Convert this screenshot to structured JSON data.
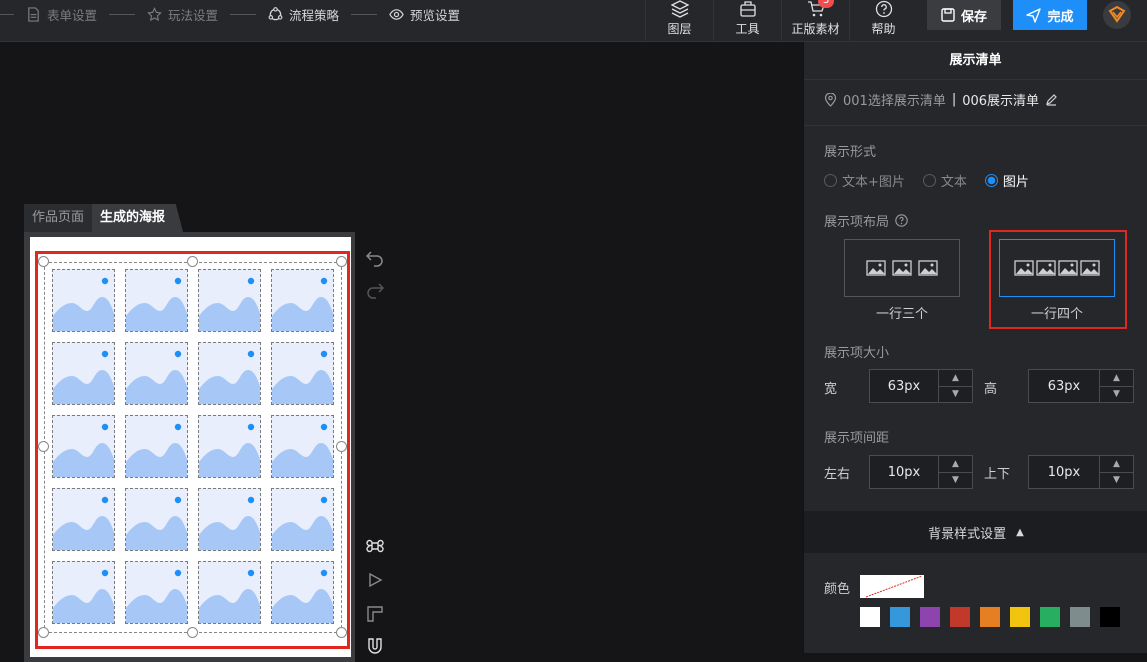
{
  "steps": [
    {
      "label": "表单设置",
      "icon": "document-icon",
      "active": false
    },
    {
      "label": "玩法设置",
      "icon": "star-icon",
      "active": false
    },
    {
      "label": "流程策略",
      "icon": "flow-icon",
      "active": true
    },
    {
      "label": "预览设置",
      "icon": "eye-icon",
      "active": true
    }
  ],
  "toolbar": {
    "layers": "图层",
    "tools": "工具",
    "assets": "正版素材",
    "assets_badge": "5",
    "help": "帮助",
    "save": "保存",
    "done": "完成"
  },
  "canvas": {
    "tab_works": "作品页面",
    "tab_poster": "生成的海报",
    "grid_rows": 5,
    "grid_cols": 4
  },
  "panel": {
    "title": "展示清单",
    "path_prefix": "001选择展示清单",
    "path_sep": "|",
    "path_current": "006展示清单",
    "display_form_label": "展示形式",
    "display_options": [
      "文本+图片",
      "文本",
      "图片"
    ],
    "display_selected": "图片",
    "layout_label": "展示项布局",
    "layout_three": "一行三个",
    "layout_four": "一行四个",
    "layout_selected": "一行四个",
    "size_label": "展示项大小",
    "width_label": "宽",
    "width_value": "63px",
    "height_label": "高",
    "height_value": "63px",
    "spacing_label": "展示项间距",
    "lr_label": "左右",
    "lr_value": "10px",
    "ud_label": "上下",
    "ud_value": "10px",
    "bg_section": "背景样式设置",
    "color_label": "颜色",
    "swatches": [
      "#ffffff",
      "#3498db",
      "#8e44ad",
      "#c0392b",
      "#e67e22",
      "#f1c40f",
      "#27ae60",
      "#7f8c8d",
      "#000000"
    ]
  }
}
